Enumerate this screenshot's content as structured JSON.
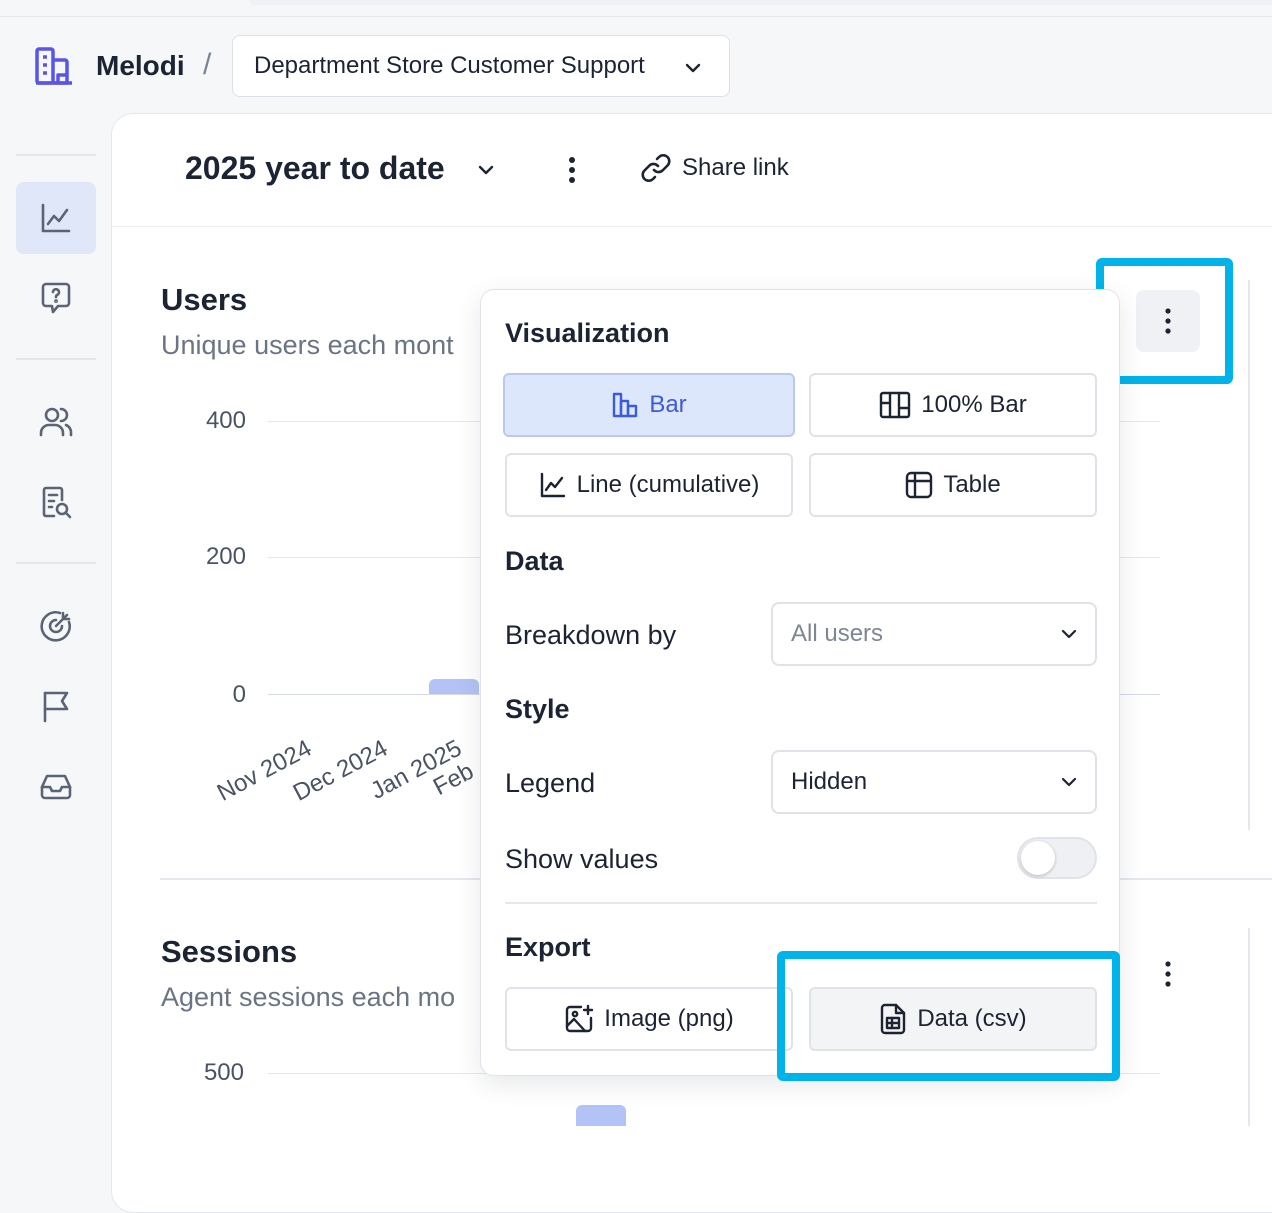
{
  "breadcrumb": {
    "brand": "Melodi",
    "separator": "/",
    "project": "Department Store Customer Support"
  },
  "header": {
    "period": "2025 year to date",
    "share_label": "Share link"
  },
  "users_chart": {
    "title": "Users",
    "subtitle": "Unique users each mont",
    "y_ticks": [
      "400",
      "200",
      "0"
    ],
    "x_labels": [
      "Nov 2024",
      "Dec 2024",
      "Jan 2025",
      "Feb"
    ]
  },
  "sessions_chart": {
    "title": "Sessions",
    "subtitle": "Agent sessions each mo",
    "y_ticks": [
      "500"
    ]
  },
  "chart_data": [
    {
      "type": "bar",
      "title": "Users",
      "categories": [
        "Nov 2024",
        "Dec 2024",
        "Jan 2025",
        "Feb"
      ],
      "values": [
        0,
        0,
        22,
        null
      ],
      "ylim": [
        0,
        400
      ],
      "grid": true,
      "legend": "hidden"
    }
  ],
  "popover": {
    "visualization_heading": "Visualization",
    "options": [
      {
        "label": "Bar",
        "icon": "bar-chart-icon",
        "selected": true
      },
      {
        "label": "100% Bar",
        "icon": "stacked-bar-icon",
        "selected": false
      },
      {
        "label": "Line (cumulative)",
        "icon": "line-chart-icon",
        "selected": false
      },
      {
        "label": "Table",
        "icon": "table-icon",
        "selected": false
      }
    ],
    "data_heading": "Data",
    "breakdown_label": "Breakdown by",
    "breakdown_value": "All users",
    "style_heading": "Style",
    "legend_label": "Legend",
    "legend_value": "Hidden",
    "show_values_label": "Show values",
    "show_values": false,
    "export_heading": "Export",
    "export_image": "Image (png)",
    "export_data": "Data (csv)"
  },
  "colors": {
    "accent": "#3d5bd6",
    "bar": "#b3c3f6",
    "highlight": "#00b4ea"
  }
}
